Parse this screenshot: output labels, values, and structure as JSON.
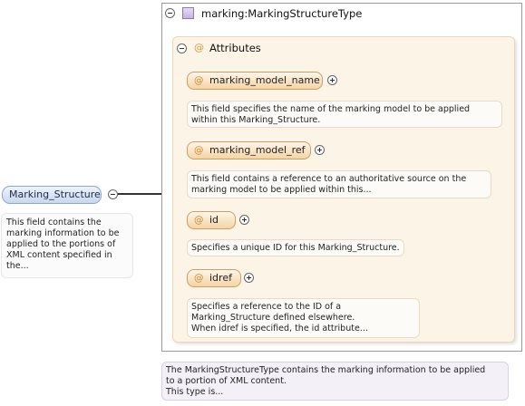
{
  "root": {
    "name": "Marking_Structure",
    "description_lines": [
      "This field contains the",
      "marking information to be",
      "applied to the portions of",
      "XML content specified in",
      "the..."
    ]
  },
  "type": {
    "name": "marking:MarkingStructureType",
    "description_lines": [
      "The MarkingStructureType contains the marking information to be applied",
      "to a portion of XML content.",
      "This type is..."
    ]
  },
  "attributes_group": {
    "at": "@",
    "label": "Attributes",
    "items": [
      {
        "at": "@",
        "name": "marking_model_name",
        "description_lines": [
          "This field specifies the name of the marking model to be applied",
          "within this Marking_Structure."
        ]
      },
      {
        "at": "@",
        "name": "marking_model_ref",
        "description_lines": [
          "This field contains a reference to an authoritative source on the",
          "marking model to be applied within this..."
        ]
      },
      {
        "at": "@",
        "name": "id",
        "description_lines": [
          "Specifies a unique ID for this Marking_Structure."
        ]
      },
      {
        "at": "@",
        "name": "idref",
        "description_lines": [
          "Specifies a reference to the ID of a",
          "Marking_Structure defined elsewhere.",
          "When idref is specified, the id attribute..."
        ]
      }
    ]
  },
  "colors": {
    "attribute_accent": "#d99a3a",
    "type_icon": "#c3b1e2",
    "root_node": "#c9d8ee"
  }
}
